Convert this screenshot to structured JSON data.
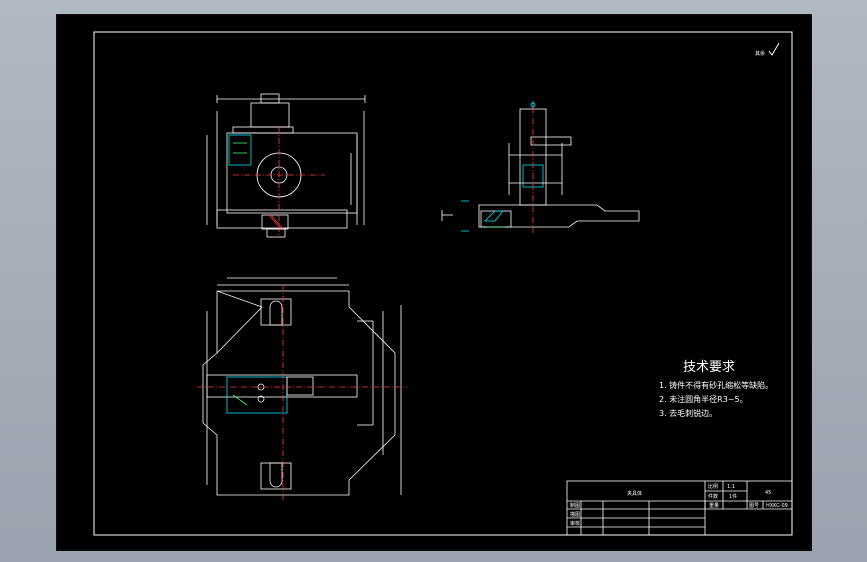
{
  "app": {
    "viewport_bg": "#a7aeb9",
    "canvas_bg": "#000000",
    "line_color": "#ffffff",
    "accent_cyan": "#00e5ff",
    "accent_green": "#33ff66",
    "accent_red": "#ff3b3b"
  },
  "roughness": {
    "label": "其余"
  },
  "requirements": {
    "title": "技术要求",
    "items": [
      "1. 铸件不得有砂孔缩松等缺陷。",
      "2. 未注圆角半径R3~5。",
      "3. 去毛刺锐边。"
    ]
  },
  "title_block": {
    "part_name": "夹具体",
    "ratio_label": "比例",
    "ratio_value": "1:1",
    "qty_label": "件数",
    "qty_value": "1件",
    "material": "45",
    "weight_label": "重量",
    "drawing_no_label": "图号",
    "drawing_no_value": "HXKC-09",
    "rows": [
      "制图",
      "描图",
      "审核"
    ]
  },
  "icons": {
    "check": "roughness-check-icon"
  }
}
